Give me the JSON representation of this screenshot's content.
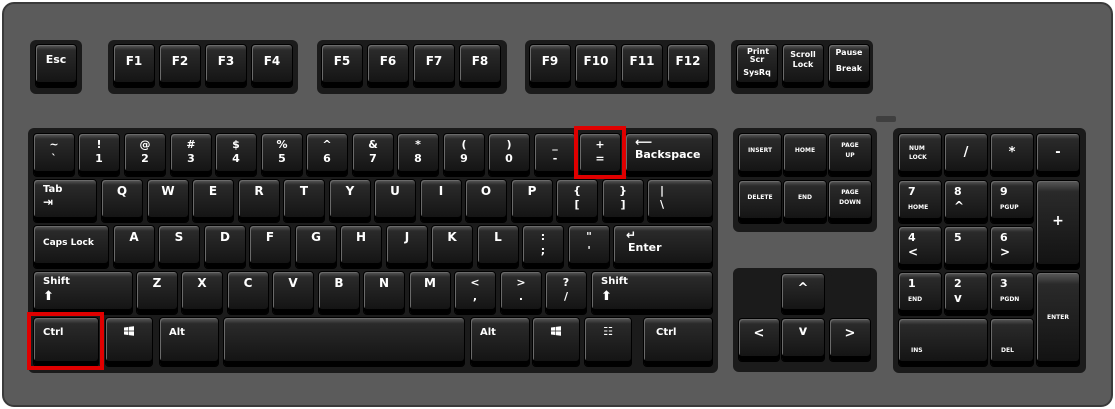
{
  "keyboard": {
    "esc": "Esc",
    "f": [
      "F1",
      "F2",
      "F3",
      "F4",
      "F5",
      "F6",
      "F7",
      "F8",
      "F9",
      "F10",
      "F11",
      "F12"
    ],
    "sys": [
      [
        "Print Scr",
        "SysRq"
      ],
      [
        "Scroll",
        "Lock"
      ],
      [
        "Pause",
        "Break"
      ]
    ],
    "number_row": [
      [
        "~",
        "`"
      ],
      [
        "!",
        "1"
      ],
      [
        "@",
        "2"
      ],
      [
        "#",
        "3"
      ],
      [
        "$",
        "4"
      ],
      [
        "%",
        "5"
      ],
      [
        "^",
        "6"
      ],
      [
        "&",
        "7"
      ],
      [
        "*",
        "8"
      ],
      [
        "(",
        "9"
      ],
      [
        ")",
        "0"
      ],
      [
        "_",
        "-"
      ],
      [
        "+",
        "="
      ]
    ],
    "backspace": "Backspace",
    "tab": "Tab",
    "row_q": [
      "Q",
      "W",
      "E",
      "R",
      "T",
      "Y",
      "U",
      "I",
      "O",
      "P"
    ],
    "brackets": [
      [
        "{",
        "["
      ],
      [
        "}",
        "]"
      ],
      [
        "|",
        "\\"
      ]
    ],
    "caps": "Caps Lock",
    "row_a": [
      "A",
      "S",
      "D",
      "F",
      "G",
      "H",
      "J",
      "K",
      "L"
    ],
    "semi": [
      [
        ":",
        ";"
      ],
      [
        "\"",
        "'"
      ]
    ],
    "enter": "Enter",
    "shift": "Shift",
    "row_z": [
      "Z",
      "X",
      "C",
      "V",
      "B",
      "N",
      "M"
    ],
    "punct": [
      [
        "<",
        ","
      ],
      [
        ">",
        "."
      ],
      [
        "?",
        "/"
      ]
    ],
    "ctrl": "Ctrl",
    "alt": "Alt",
    "nav": [
      [
        "INSERT"
      ],
      [
        "HOME"
      ],
      [
        "PAGE",
        "UP"
      ],
      [
        "DELETE"
      ],
      [
        "END"
      ],
      [
        "PAGE",
        "DOWN"
      ]
    ],
    "arrows": {
      "up": "^",
      "left": "<",
      "down": "v",
      "right": ">"
    },
    "numpad": {
      "numlock": [
        "NUM",
        "LOCK"
      ],
      "slash": "/",
      "star": "*",
      "minus": "-",
      "plus": "+",
      "n7": [
        "7",
        "HOME"
      ],
      "n8": [
        "8",
        "^"
      ],
      "n9": [
        "9",
        "PGUP"
      ],
      "n4": [
        "4",
        "<"
      ],
      "n5": "5",
      "n6": [
        "6",
        ">"
      ],
      "n1": [
        "1",
        "END"
      ],
      "n2": [
        "2",
        "v"
      ],
      "n3": [
        "3",
        "PGDN"
      ],
      "enter": "ENTER",
      "ins": "INS",
      "del": "DEL"
    },
    "colors": {
      "board": "#5b5b5b",
      "key": "#1e1e1e",
      "highlight": "#e00000"
    }
  }
}
